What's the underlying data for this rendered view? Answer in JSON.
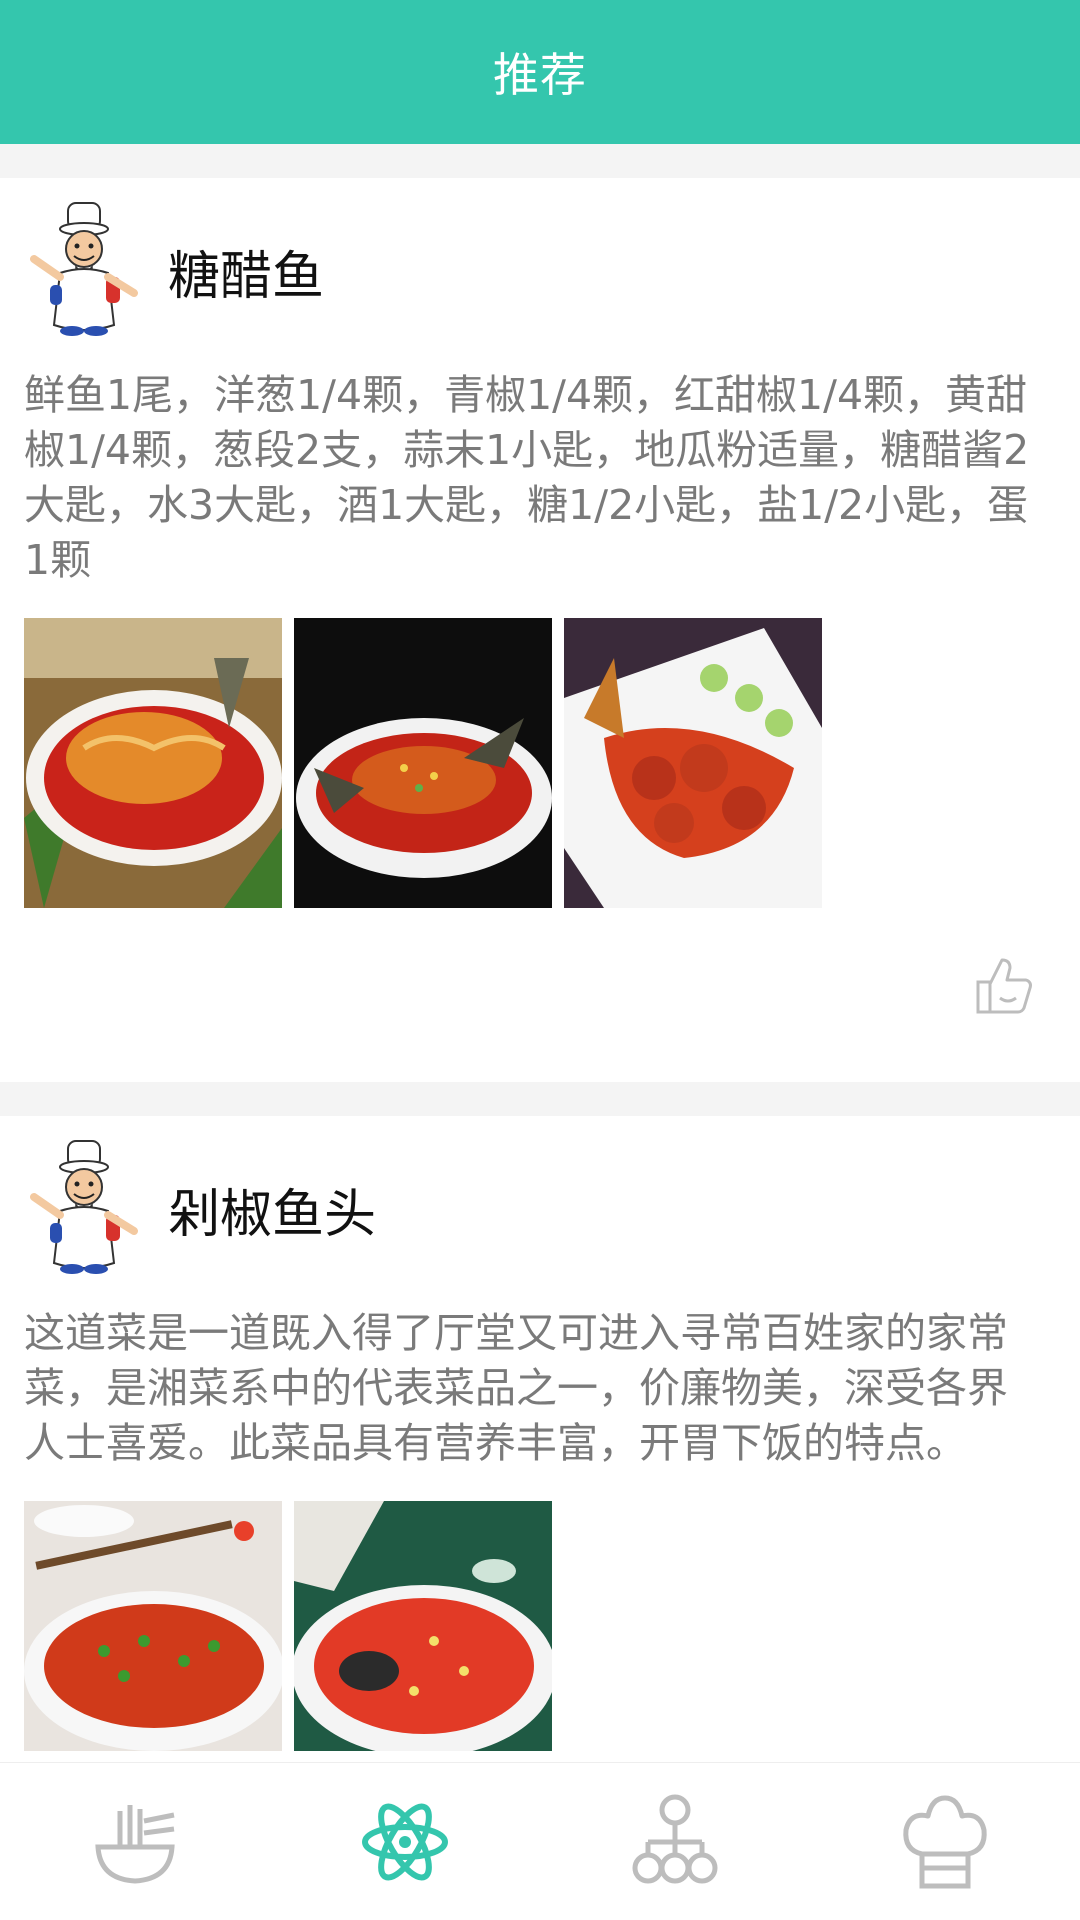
{
  "header": {
    "title": "推荐"
  },
  "colors": {
    "accent": "#34c6ad",
    "text_dark": "#111111",
    "text_muted": "#7a7a7a",
    "icon_inactive": "#bdbdbd"
  },
  "posts": [
    {
      "title": "糖醋鱼",
      "description": "鲜鱼1尾，洋葱1/4颗，青椒1/4颗，红甜椒1/4颗，黄甜椒1/4颗，葱段2支，蒜末1小匙，地瓜粉适量，糖醋酱2大匙，水3大匙，酒1大匙，糖1/2小匙，盐1/2小匙，蛋1颗",
      "photos": [
        "sweet-sour-fish-photo-1",
        "sweet-sour-fish-photo-2",
        "sweet-sour-fish-photo-3"
      ],
      "actions": {
        "like_icon": "thumbs-up-icon"
      }
    },
    {
      "title": "剁椒鱼头",
      "description": "这道菜是一道既入得了厅堂又可进入寻常百姓家的家常菜，是湘菜系中的代表菜品之一，价廉物美，深受各界人士喜爱。此菜品具有营养丰富，开胃下饭的特点。",
      "photos": [
        "chopped-chili-fish-head-photo-1",
        "chopped-chili-fish-head-photo-2"
      ]
    }
  ],
  "bottom_nav": {
    "items": [
      {
        "icon": "noodle-bowl-icon",
        "active": false
      },
      {
        "icon": "atom-icon",
        "active": true
      },
      {
        "icon": "hierarchy-icon",
        "active": false
      },
      {
        "icon": "chef-hat-icon",
        "active": false
      }
    ]
  }
}
